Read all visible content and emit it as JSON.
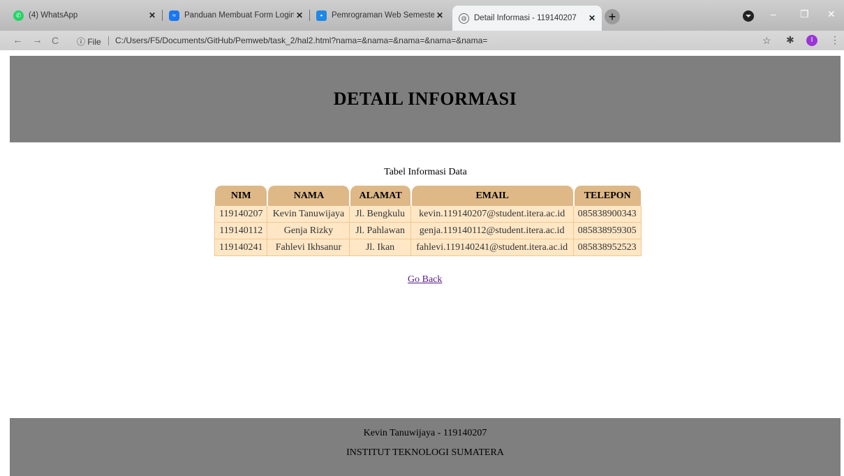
{
  "browser": {
    "tabs": [
      {
        "title": "(4) WhatsApp",
        "icon": "whatsapp-icon",
        "color": "#25d366"
      },
      {
        "title": "Panduan Membuat Form Login d",
        "icon": "messenger-icon",
        "color": "#1877f2"
      },
      {
        "title": "Pemrograman Web Semester Ga",
        "icon": "classroom-icon",
        "color": "#1e88e5"
      },
      {
        "title": "Detail Informasi - 119140207",
        "icon": "globe-icon",
        "color": "#666666"
      }
    ],
    "new_tab": "+",
    "url_info": "File",
    "url": "C:/Users/F5/Documents/GitHub/Pemweb/task_2/hal2.html?nama=&nama=&nama=&nama=&nama=",
    "avatar_letter": "I"
  },
  "page": {
    "heading": "DETAIL INFORMASI",
    "caption": "Tabel Informasi Data",
    "columns": [
      "NIM",
      "NAMA",
      "ALAMAT",
      "EMAIL",
      "TELEPON"
    ],
    "rows": [
      [
        "119140207",
        "Kevin Tanuwijaya",
        "Jl. Bengkulu",
        "kevin.119140207@student.itera.ac.id",
        "085838900343"
      ],
      [
        "119140112",
        "Genja Rizky",
        "Jl. Pahlawan",
        "genja.119140112@student.itera.ac.id",
        "085838959305"
      ],
      [
        "119140241",
        "Fahlevi Ikhsanur",
        "Jl. Ikan",
        "fahlevi.119140241@student.itera.ac.id",
        "085838952523"
      ]
    ],
    "go_back": "Go Back",
    "footer_name": "Kevin Tanuwijaya - 119140207",
    "footer_institution": "INSTITUT TEKNOLOGI SUMATERA"
  }
}
